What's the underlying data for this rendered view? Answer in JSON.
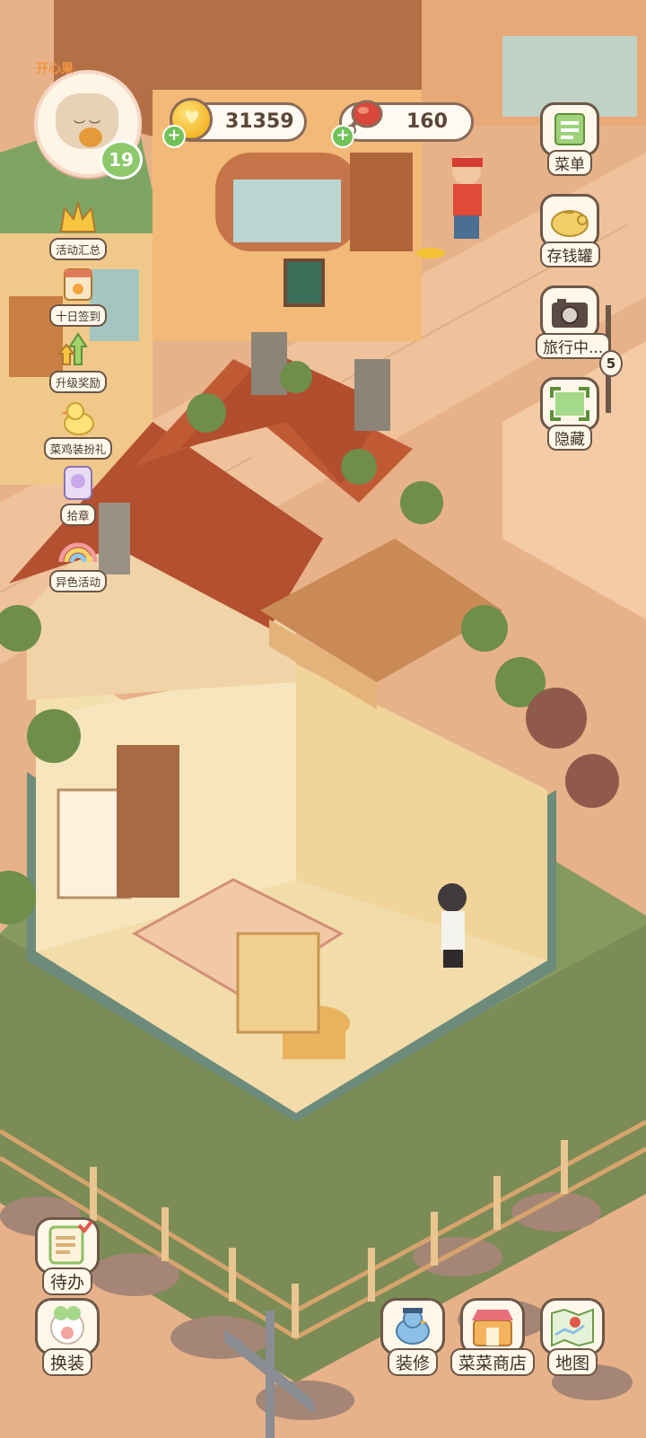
{
  "player": {
    "badge": "开心果",
    "level": "19"
  },
  "currencies": {
    "coins": "31359",
    "food": "160"
  },
  "left_menu": [
    {
      "label": "活动汇总",
      "icon": "crown-icon"
    },
    {
      "label": "十日签到",
      "icon": "calendar-icon"
    },
    {
      "label": "升级奖励",
      "icon": "upgrade-arrows-icon"
    },
    {
      "label": "菜鸡装扮礼",
      "icon": "duck-icon"
    },
    {
      "label": "拾章",
      "icon": "badge-stamp-icon"
    },
    {
      "label": "异色活动",
      "icon": "rainbow-icon"
    }
  ],
  "right_menu": [
    {
      "label": "菜单",
      "icon": "menu-list-icon"
    },
    {
      "label": "存钱罐",
      "icon": "piggy-bank-icon"
    },
    {
      "label": "旅行中...",
      "icon": "camera-icon"
    },
    {
      "label": "隐藏",
      "icon": "hide-frame-icon"
    }
  ],
  "travel_count": "5",
  "bottom_left": [
    {
      "label": "待办",
      "icon": "todo-list-icon"
    },
    {
      "label": "换装",
      "icon": "outfit-icon"
    }
  ],
  "bottom_right": [
    {
      "label": "装修",
      "icon": "decorate-bird-icon"
    },
    {
      "label": "菜菜商店",
      "icon": "shop-icon"
    },
    {
      "label": "地图",
      "icon": "map-icon"
    }
  ],
  "colors": {
    "accent_green": "#72c25a",
    "panel_border": "#6d5747",
    "panel_bg": "#fff7ea"
  }
}
